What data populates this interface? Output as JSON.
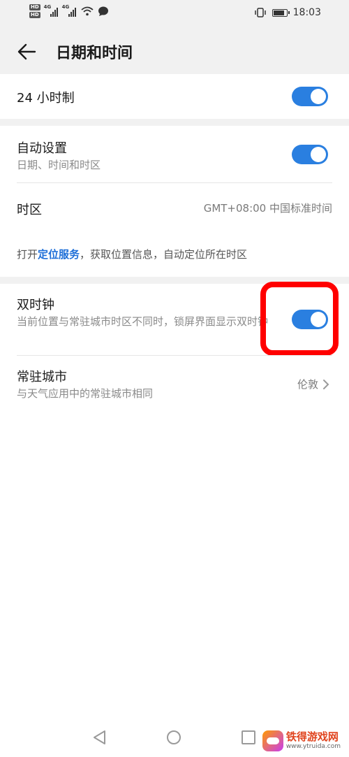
{
  "status_bar": {
    "time": "18:03",
    "hd1": "HD",
    "hd2": "HD",
    "net1": "4G",
    "net2": "4G"
  },
  "header": {
    "title": "日期和时间",
    "back_icon": "arrow-left-icon"
  },
  "settings": {
    "hour24": {
      "label": "24 小时制",
      "on": true
    },
    "auto_set": {
      "label": "自动设置",
      "sub": "日期、时间和时区",
      "on": true
    },
    "timezone": {
      "label": "时区",
      "value": "GMT+08:00 中国标准时间"
    },
    "location_tip": {
      "prefix": "打开",
      "link": "定位服务",
      "suffix": "，获取位置信息，自动定位所在时区"
    },
    "dual_clock": {
      "label": "双时钟",
      "sub": "当前位置与常驻城市时区不同时，锁屏界面显示双时钟",
      "on": true
    },
    "home_city": {
      "label": "常驻城市",
      "sub": "与天气应用中的常驻城市相同",
      "value": "伦敦"
    }
  },
  "colors": {
    "accent": "#2a7fe0",
    "highlight": "#ff0000",
    "link": "#1e6fd8"
  },
  "watermark": {
    "name": "铁得游戏网",
    "url": "www.ytruida.com"
  }
}
